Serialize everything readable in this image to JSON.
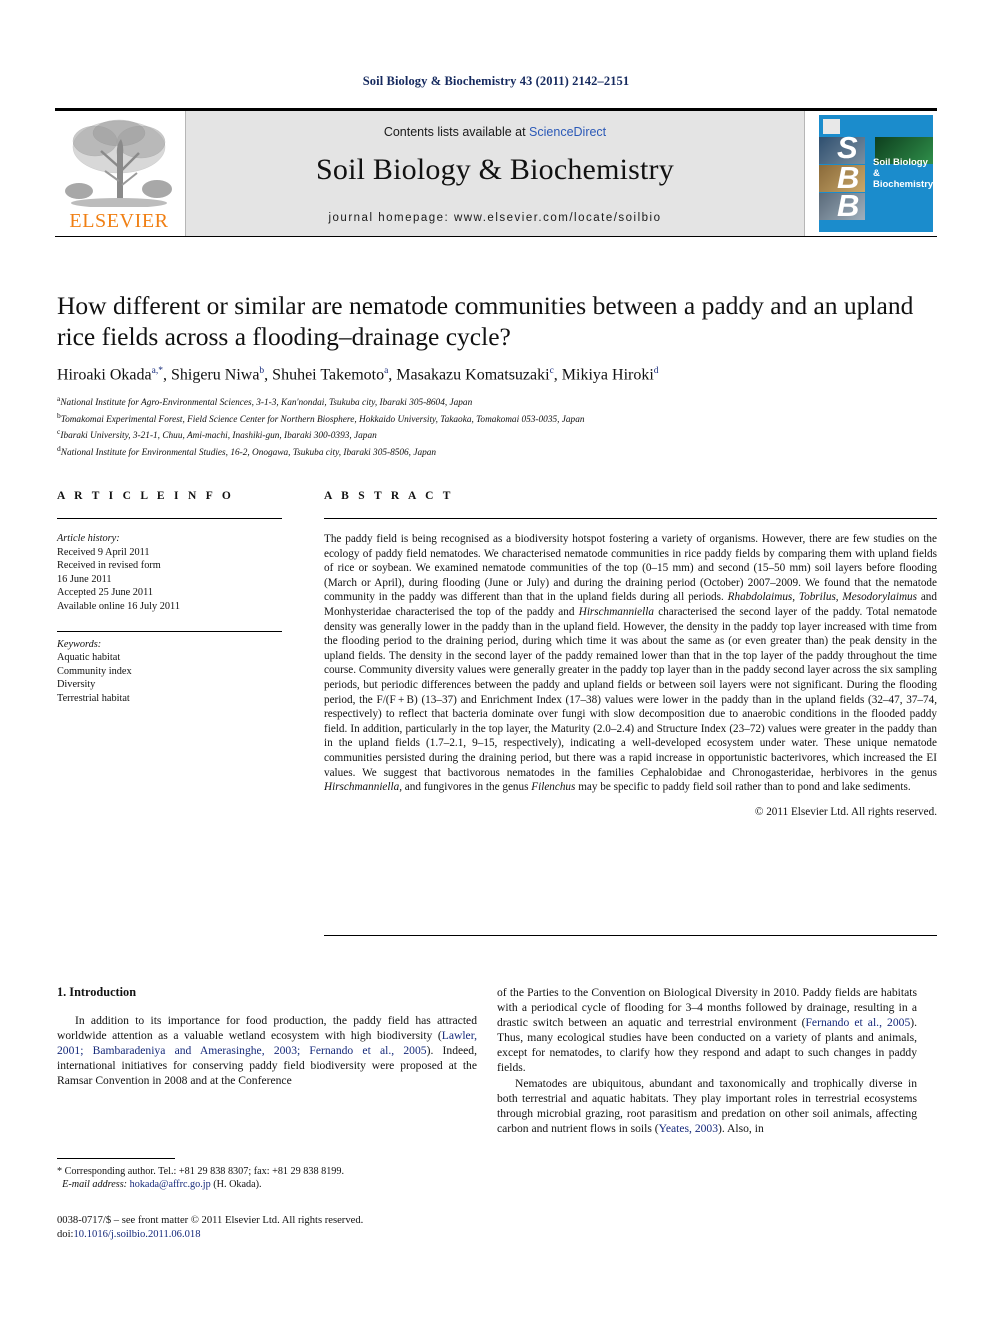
{
  "running_head": "Soil Biology & Biochemistry 43 (2011) 2142–2151",
  "masthead": {
    "contents_prefix": "Contents lists available at ",
    "sciencedirect": "ScienceDirect",
    "journal_title": "Soil Biology & Biochemistry",
    "homepage": "journal homepage: www.elsevier.com/locate/soilbio",
    "publisher_wordmark": "ELSEVIER",
    "publisher_logo_icon": "elsevier-tree-logo",
    "cover": {
      "initials": [
        "S",
        "B",
        "B"
      ],
      "name": "Soil Biology & Biochemistry",
      "background_color": "#1b8ccc"
    }
  },
  "article": {
    "title": "How different or similar are nematode communities between a paddy and an upland rice fields across a flooding–drainage cycle?",
    "authors": [
      {
        "name": "Hiroaki Okada",
        "marks": "a,*"
      },
      {
        "name": "Shigeru Niwa",
        "marks": "b"
      },
      {
        "name": "Shuhei Takemoto",
        "marks": "a"
      },
      {
        "name": "Masakazu Komatsuzaki",
        "marks": "c"
      },
      {
        "name": "Mikiya Hiroki",
        "marks": "d"
      }
    ],
    "affiliations": [
      {
        "mark": "a",
        "text": "National Institute for Agro-Environmental Sciences, 3-1-3, Kan'nondai, Tsukuba city, Ibaraki 305-8604, Japan"
      },
      {
        "mark": "b",
        "text": "Tomakomai Experimental Forest, Field Science Center for Northern Biosphere, Hokkaido University, Takaoka, Tomakomai 053-0035, Japan"
      },
      {
        "mark": "c",
        "text": "Ibaraki University, 3-21-1, Chuu, Ami-machi, Inashiki-gun, Ibaraki 300-0393, Japan"
      },
      {
        "mark": "d",
        "text": "National Institute for Environmental Studies, 16-2, Onogawa, Tsukuba city, Ibaraki 305-8506, Japan"
      }
    ]
  },
  "article_info": {
    "heading": "A R T I C L E   I N F O",
    "history_label": "Article history:",
    "history": [
      "Received 9 April 2011",
      "Received in revised form",
      "16 June 2011",
      "Accepted 25 June 2011",
      "Available online 16 July 2011"
    ],
    "keywords_label": "Keywords:",
    "keywords": [
      "Aquatic habitat",
      "Community index",
      "Diversity",
      "Terrestrial habitat"
    ]
  },
  "abstract": {
    "heading": "A B S T R A C T",
    "paragraph_1": "The paddy field is being recognised as a biodiversity hotspot fostering a variety of organisms. However, there are few studies on the ecology of paddy field nematodes. We characterised nematode communities in rice paddy fields by comparing them with upland fields of rice or soybean. We examined nematode communities of the top (0–15 mm) and second (15–50 mm) soil layers before flooding (March or April), during flooding (June or July) and during the draining period (October) 2007–2009. We found that the nematode community in the paddy was different than that in the upland fields during all periods. ",
    "taxa_1": "Rhabdolaimus, Tobrilus, Mesodorylaimus",
    "paragraph_2": " and Monhysteridae characterised the top of the paddy and ",
    "taxa_2": "Hirschmanniella",
    "paragraph_3": " characterised the second layer of the paddy. Total nematode density was generally lower in the paddy than in the upland field. However, the density in the paddy top layer increased with time from the flooding period to the draining period, during which time it was about the same as (or even greater than) the peak density in the upland fields. The density in the second layer of the paddy remained lower than that in the top layer of the paddy throughout the time course. Community diversity values were generally greater in the paddy top layer than in the paddy second layer across the six sampling periods, but periodic differences between the paddy and upland fields or between soil layers were not significant. During the flooding period, the F/(F + B) (13–37) and Enrichment Index (17–38) values were lower in the paddy than in the upland fields (32–47, 37–74, respectively) to reflect that bacteria dominate over fungi with slow decomposition due to anaerobic conditions in the flooded paddy field. In addition, particularly in the top layer, the Maturity (2.0–2.4) and Structure Index (23–72) values were greater in the paddy than in the upland fields (1.7–2.1, 9–15, respectively), indicating a well-developed ecosystem under water. These unique nematode communities persisted during the draining period, but there was a rapid increase in opportunistic bacterivores, which increased the EI values. We suggest that bactivorous nematodes in the families Cephalobidae and Chronogasteridae, herbivores in the genus ",
    "taxa_3": "Hirschmanniella",
    "paragraph_4": ", and fungivores in the genus ",
    "taxa_4": "Filenchus",
    "paragraph_5": " may be specific to paddy field soil rather than to pond and lake sediments.",
    "copyright": "© 2011 Elsevier Ltd. All rights reserved."
  },
  "introduction": {
    "section_title": "1.  Introduction",
    "left_p1_a": "In addition to its importance for food production, the paddy field has attracted worldwide attention as a valuable wetland ecosystem with high biodiversity (",
    "left_p1_cite": "Lawler, 2001; Bambaradeniya and Amerasinghe, 2003; Fernando et al., 2005",
    "left_p1_b": "). Indeed, international initiatives for conserving paddy field biodiversity were proposed at the Ramsar Convention in 2008 and at the Conference",
    "right_p1_a": "of the Parties to the Convention on Biological Diversity in 2010. Paddy fields are habitats with a periodical cycle of flooding for 3–4 months followed by drainage, resulting in a drastic switch between an aquatic and terrestrial environment (",
    "right_p1_cite": "Fernando et al., 2005",
    "right_p1_b": "). Thus, many ecological studies have been conducted on a variety of plants and animals, except for nematodes, to clarify how they respond and adapt to such changes in paddy fields.",
    "right_p2_a": "Nematodes are ubiquitous, abundant and taxonomically and trophically diverse in both terrestrial and aquatic habitats. They play important roles in terrestrial ecosystems through microbial grazing, root parasitism and predation on other soil animals, affecting carbon and nutrient flows in soils (",
    "right_p2_cite": "Yeates, 2003",
    "right_p2_b": "). Also, in"
  },
  "footnote": {
    "corresponding": "* Corresponding author. Tel.: +81 29 838 8307; fax: +81 29 838 8199.",
    "email_label": "E-mail address:",
    "email": "hokada@affrc.go.jp",
    "email_suffix": "(H. Okada)."
  },
  "footer": {
    "issn_line": "0038-0717/$ – see front matter © 2011 Elsevier Ltd. All rights reserved.",
    "doi_label": "doi:",
    "doi": "10.1016/j.soilbio.2011.06.018"
  }
}
